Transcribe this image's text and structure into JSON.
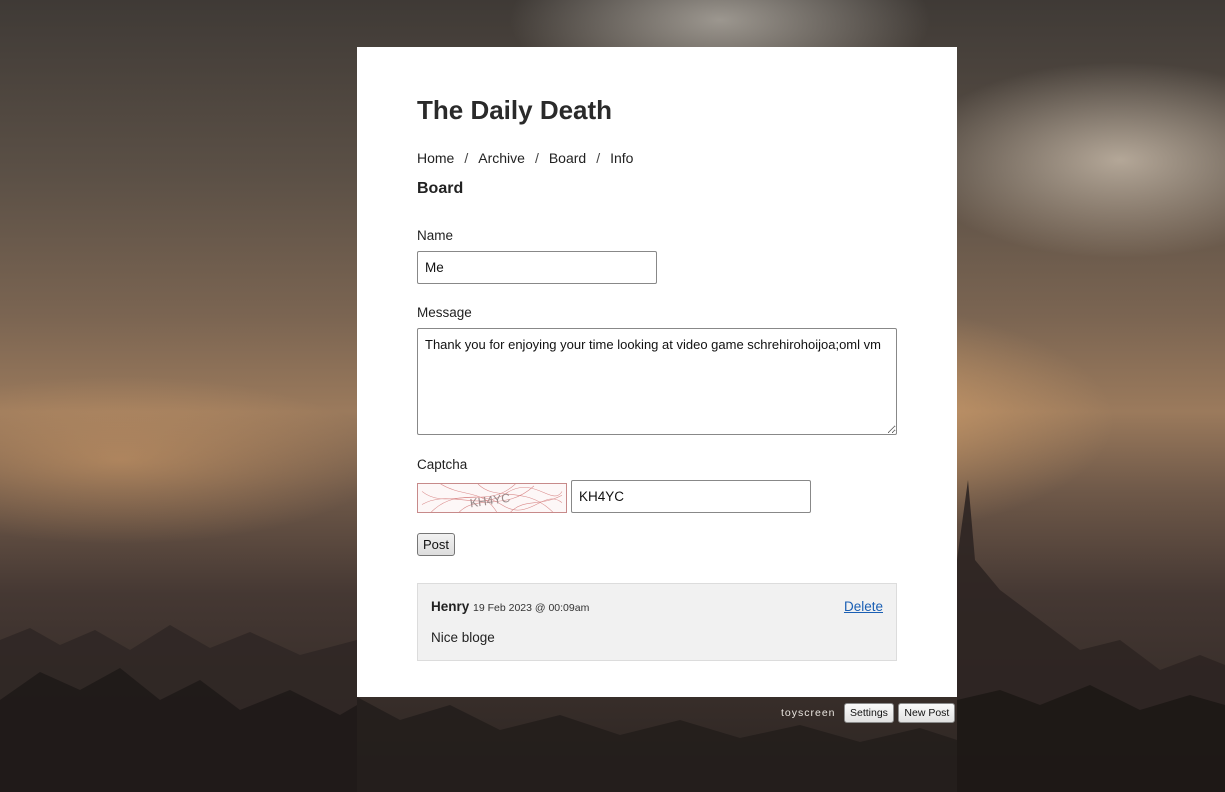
{
  "site": {
    "title": "The Daily Death"
  },
  "nav": {
    "items": [
      {
        "label": "Home"
      },
      {
        "label": "Archive"
      },
      {
        "label": "Board"
      },
      {
        "label": "Info"
      }
    ],
    "separator": "/"
  },
  "page": {
    "heading": "Board"
  },
  "form": {
    "name_label": "Name",
    "name_value": "Me",
    "message_label": "Message",
    "message_value": "Thank you for enjoying your time looking at video game schrehirohoijoa;oml vm",
    "captcha_label": "Captcha",
    "captcha_image_text": "KH4YC",
    "captcha_value": "KH4YC",
    "post_label": "Post"
  },
  "comments": [
    {
      "author": "Henry",
      "date": "19 Feb 2023 @ 00:09am",
      "body": "Nice bloge",
      "delete_label": "Delete"
    }
  ],
  "footer": {
    "brand": "toyscreen",
    "settings_label": "Settings",
    "new_post_label": "New Post"
  }
}
